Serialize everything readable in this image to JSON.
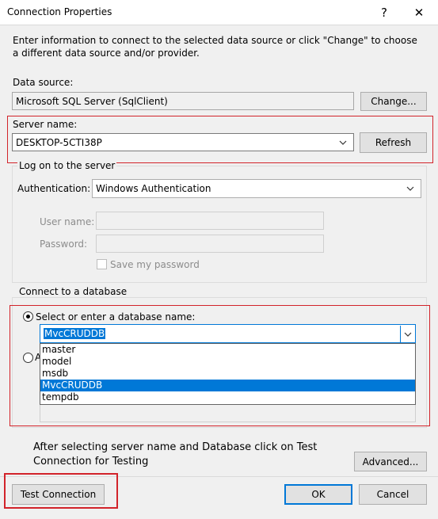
{
  "window": {
    "title": "Connection Properties",
    "help_glyph": "?",
    "close_glyph": "✕"
  },
  "intro_text": "Enter information to connect to the selected data source or click \"Change\" to choose a different data source and/or provider.",
  "data_source": {
    "label": "Data source:",
    "value": "Microsoft SQL Server (SqlClient)",
    "change_label": "Change..."
  },
  "server": {
    "label": "Server name:",
    "value": "DESKTOP-5CTI38P",
    "refresh_label": "Refresh"
  },
  "logon": {
    "group_label": "Log on to the server",
    "auth_label": "Authentication:",
    "auth_value": "Windows Authentication",
    "username_label": "User name:",
    "password_label": "Password:",
    "save_password_label": "Save my password"
  },
  "database": {
    "group_label": "Connect to a database",
    "select_option_label": "Select or enter a database name:",
    "selected_value": "MvcCRUDDB",
    "attach_option_partial": "A",
    "options": [
      "master",
      "model",
      "msdb",
      "MvcCRUDDB",
      "tempdb"
    ]
  },
  "annotation": {
    "note": "After selecting server name and Database click on Test Connection for Testing"
  },
  "buttons": {
    "advanced": "Advanced...",
    "test_connection": "Test Connection",
    "ok": "OK",
    "cancel": "Cancel"
  },
  "colors": {
    "highlight": "#0078d7",
    "annotation_red": "#d2232a"
  }
}
